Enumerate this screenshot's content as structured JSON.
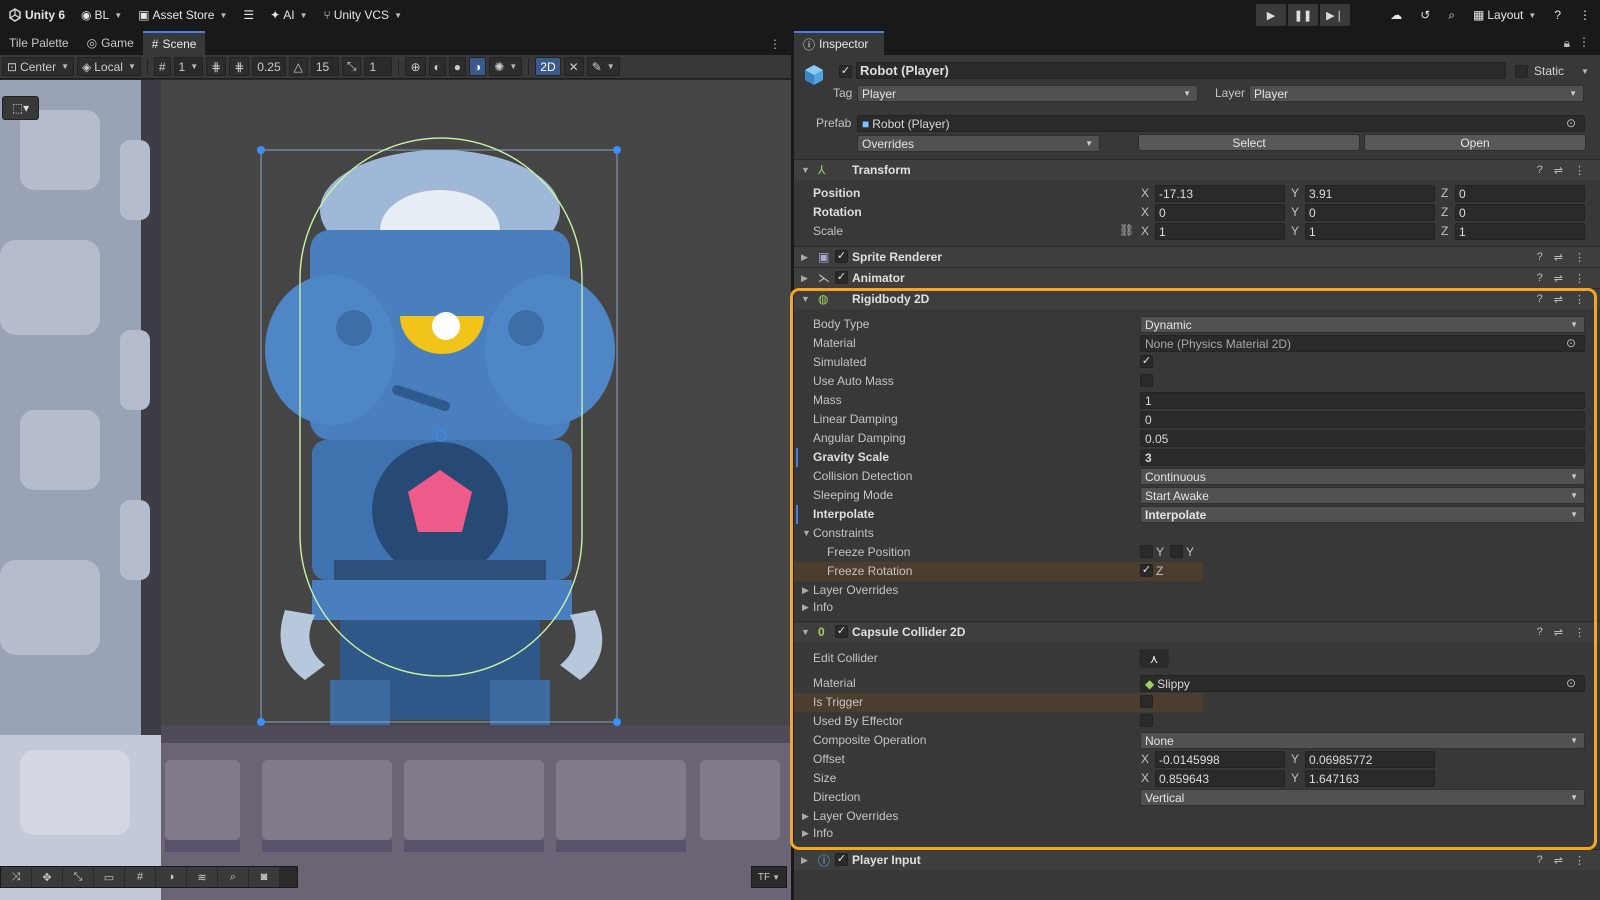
{
  "topbar": {
    "app": "Unity 6",
    "account": "BL",
    "asset_store": "Asset Store",
    "ai": "AI",
    "vcs": "Unity VCS",
    "layout": "Layout"
  },
  "left_tabs": [
    "Tile Palette",
    "Game",
    "Scene"
  ],
  "scene_toolbar": {
    "pivot": "Center",
    "space": "Local",
    "grid_value": "1",
    "snap_increment": "0.25",
    "rotate_snap": "15",
    "scale_snap": "1",
    "mode_2d": "2D",
    "tf_label": "TF"
  },
  "inspector": {
    "tab": "Inspector",
    "object_name": "Robot (Player)",
    "static_label": "Static",
    "tag_label": "Tag",
    "tag_value": "Player",
    "layer_label": "Layer",
    "layer_value": "Player",
    "prefab_label": "Prefab",
    "prefab_value": "Robot (Player)",
    "overrides": "Overrides",
    "select": "Select",
    "open": "Open",
    "transform": {
      "title": "Transform",
      "position_label": "Position",
      "rotation_label": "Rotation",
      "scale_label": "Scale",
      "position": {
        "x": "-17.13",
        "y": "3.91",
        "z": "0"
      },
      "rotation": {
        "x": "0",
        "y": "0",
        "z": "0"
      },
      "scale": {
        "x": "1",
        "y": "1",
        "z": "1"
      }
    },
    "sprite_renderer": "Sprite Renderer",
    "animator": "Animator",
    "rigidbody": {
      "title": "Rigidbody 2D",
      "body_type_label": "Body Type",
      "body_type": "Dynamic",
      "material_label": "Material",
      "material": "None (Physics Material 2D)",
      "simulated_label": "Simulated",
      "auto_mass_label": "Use Auto Mass",
      "mass_label": "Mass",
      "mass": "1",
      "linear_damping_label": "Linear Damping",
      "linear_damping": "0",
      "angular_damping_label": "Angular Damping",
      "angular_damping": "0.05",
      "gravity_label": "Gravity Scale",
      "gravity": "3",
      "collision_label": "Collision Detection",
      "collision": "Continuous",
      "sleeping_label": "Sleeping Mode",
      "sleeping": "Start Awake",
      "interpolate_label": "Interpolate",
      "interpolate": "Interpolate",
      "constraints_label": "Constraints",
      "freeze_pos_label": "Freeze Position",
      "freeze_rot_label": "Freeze Rotation",
      "axis_y": "Y",
      "axis_z": "Z",
      "layer_overrides": "Layer Overrides",
      "info": "Info"
    },
    "capsule": {
      "title": "Capsule Collider 2D",
      "edit_label": "Edit Collider",
      "material_label": "Material",
      "material": "Slippy",
      "trigger_label": "Is Trigger",
      "effector_label": "Used By Effector",
      "composite_label": "Composite Operation",
      "composite": "None",
      "offset_label": "Offset",
      "offset": {
        "x": "-0.0145998",
        "y": "0.06985772"
      },
      "size_label": "Size",
      "size": {
        "x": "0.859643",
        "y": "1.647163"
      },
      "direction_label": "Direction",
      "direction": "Vertical",
      "layer_overrides": "Layer Overrides",
      "info": "Info"
    },
    "player_input": "Player Input"
  },
  "axis_labels": {
    "x": "X",
    "y": "Y",
    "z": "Z"
  },
  "colors": {
    "highlight": "#f5a623",
    "accent": "#4c7ee0"
  }
}
